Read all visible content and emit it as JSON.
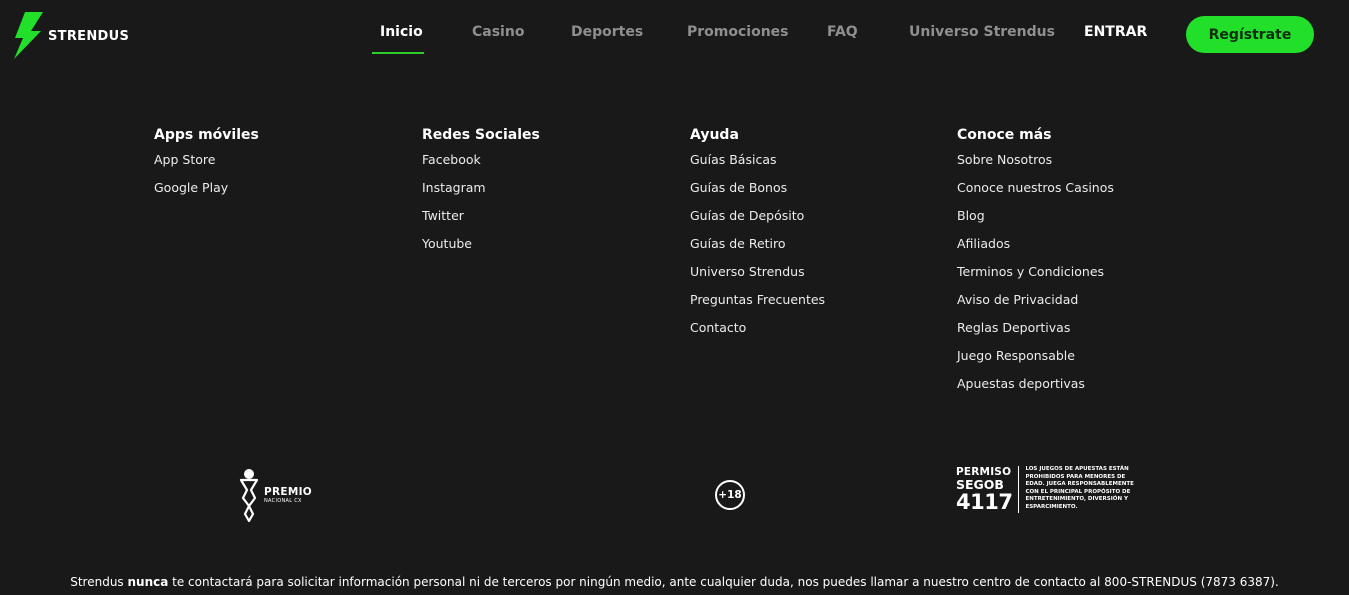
{
  "brand": {
    "name": "STRENDUS",
    "accent_color": "#22e02a",
    "logo_icon": "lightning-bolt-icon"
  },
  "nav": {
    "items": [
      {
        "label": "Inicio",
        "active": true
      },
      {
        "label": "Casino",
        "active": false
      },
      {
        "label": "Deportes",
        "active": false
      },
      {
        "label": "Promociones",
        "active": false
      },
      {
        "label": "FAQ",
        "active": false
      },
      {
        "label": "Universo Strendus",
        "active": false
      }
    ],
    "login_label": "ENTRAR",
    "register_label": "Regístrate"
  },
  "footer": {
    "columns": [
      {
        "title": "Apps móviles",
        "links": [
          "App Store",
          "Google Play"
        ]
      },
      {
        "title": "Redes Sociales",
        "links": [
          "Facebook",
          "Instagram",
          "Twitter",
          "Youtube"
        ]
      },
      {
        "title": "Ayuda",
        "links": [
          "Guías Básicas",
          "Guías de Bonos",
          "Guías de Depósito",
          "Guías de Retiro",
          "Universo Strendus",
          "Preguntas Frecuentes",
          "Contacto"
        ]
      },
      {
        "title": "Conoce más",
        "links": [
          "Sobre Nosotros",
          "Conoce nuestros Casinos",
          "Blog",
          "Afiliados",
          "Terminos y Condiciones",
          "Aviso de Privacidad",
          "Reglas Deportivas",
          "Juego Responsable",
          "Apuestas deportivas"
        ]
      }
    ],
    "premio": {
      "title": "PREMIO",
      "subtitle": "NACIONAL CX"
    },
    "age_badge": "+18",
    "permiso": {
      "line1": "PERMISO",
      "line2": "SEGOB",
      "line3": "4117",
      "note": "LOS JUEGOS DE APUESTAS ESTÁN PROHIBIDOS PARA MENORES DE EDAD. JUEGA RESPONSABLEMENTE CON EL PRINCIPAL PROPÓSITO DE ENTRETENIMIENTO, DIVERSIÓN Y ESPARCIMIENTO."
    },
    "contact_note": {
      "prefix": "Strendus ",
      "emphasis": "nunca",
      "suffix": " te contactará para solicitar información personal ni de terceros por ningún medio, ante cualquier duda, nos puedes llamar a nuestro centro de contacto al 800-STRENDUS (7873 6387)."
    }
  }
}
